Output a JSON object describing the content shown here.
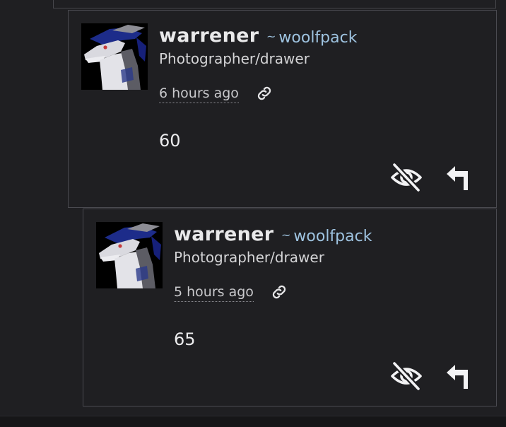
{
  "comments": [
    {
      "username": "warrener",
      "community": "woolfpack",
      "community_prefix": "~",
      "bio": "Photographer/drawer",
      "time": "6 hours ago",
      "body": "60",
      "icons": {
        "avatar": "avatar-image",
        "permalink": "link-icon",
        "hide": "eye-off-icon",
        "reply": "reply-icon"
      }
    },
    {
      "username": "warrener",
      "community": "woolfpack",
      "community_prefix": "~",
      "bio": "Photographer/drawer",
      "time": "5 hours ago",
      "body": "65",
      "icons": {
        "avatar": "avatar-image",
        "permalink": "link-icon",
        "hide": "eye-off-icon",
        "reply": "reply-icon"
      }
    }
  ],
  "colors": {
    "background": "#1f1f22",
    "border": "#4a4a50",
    "username": "#e9e9ea",
    "community": "#9ec3e0",
    "text": "#ececee"
  }
}
